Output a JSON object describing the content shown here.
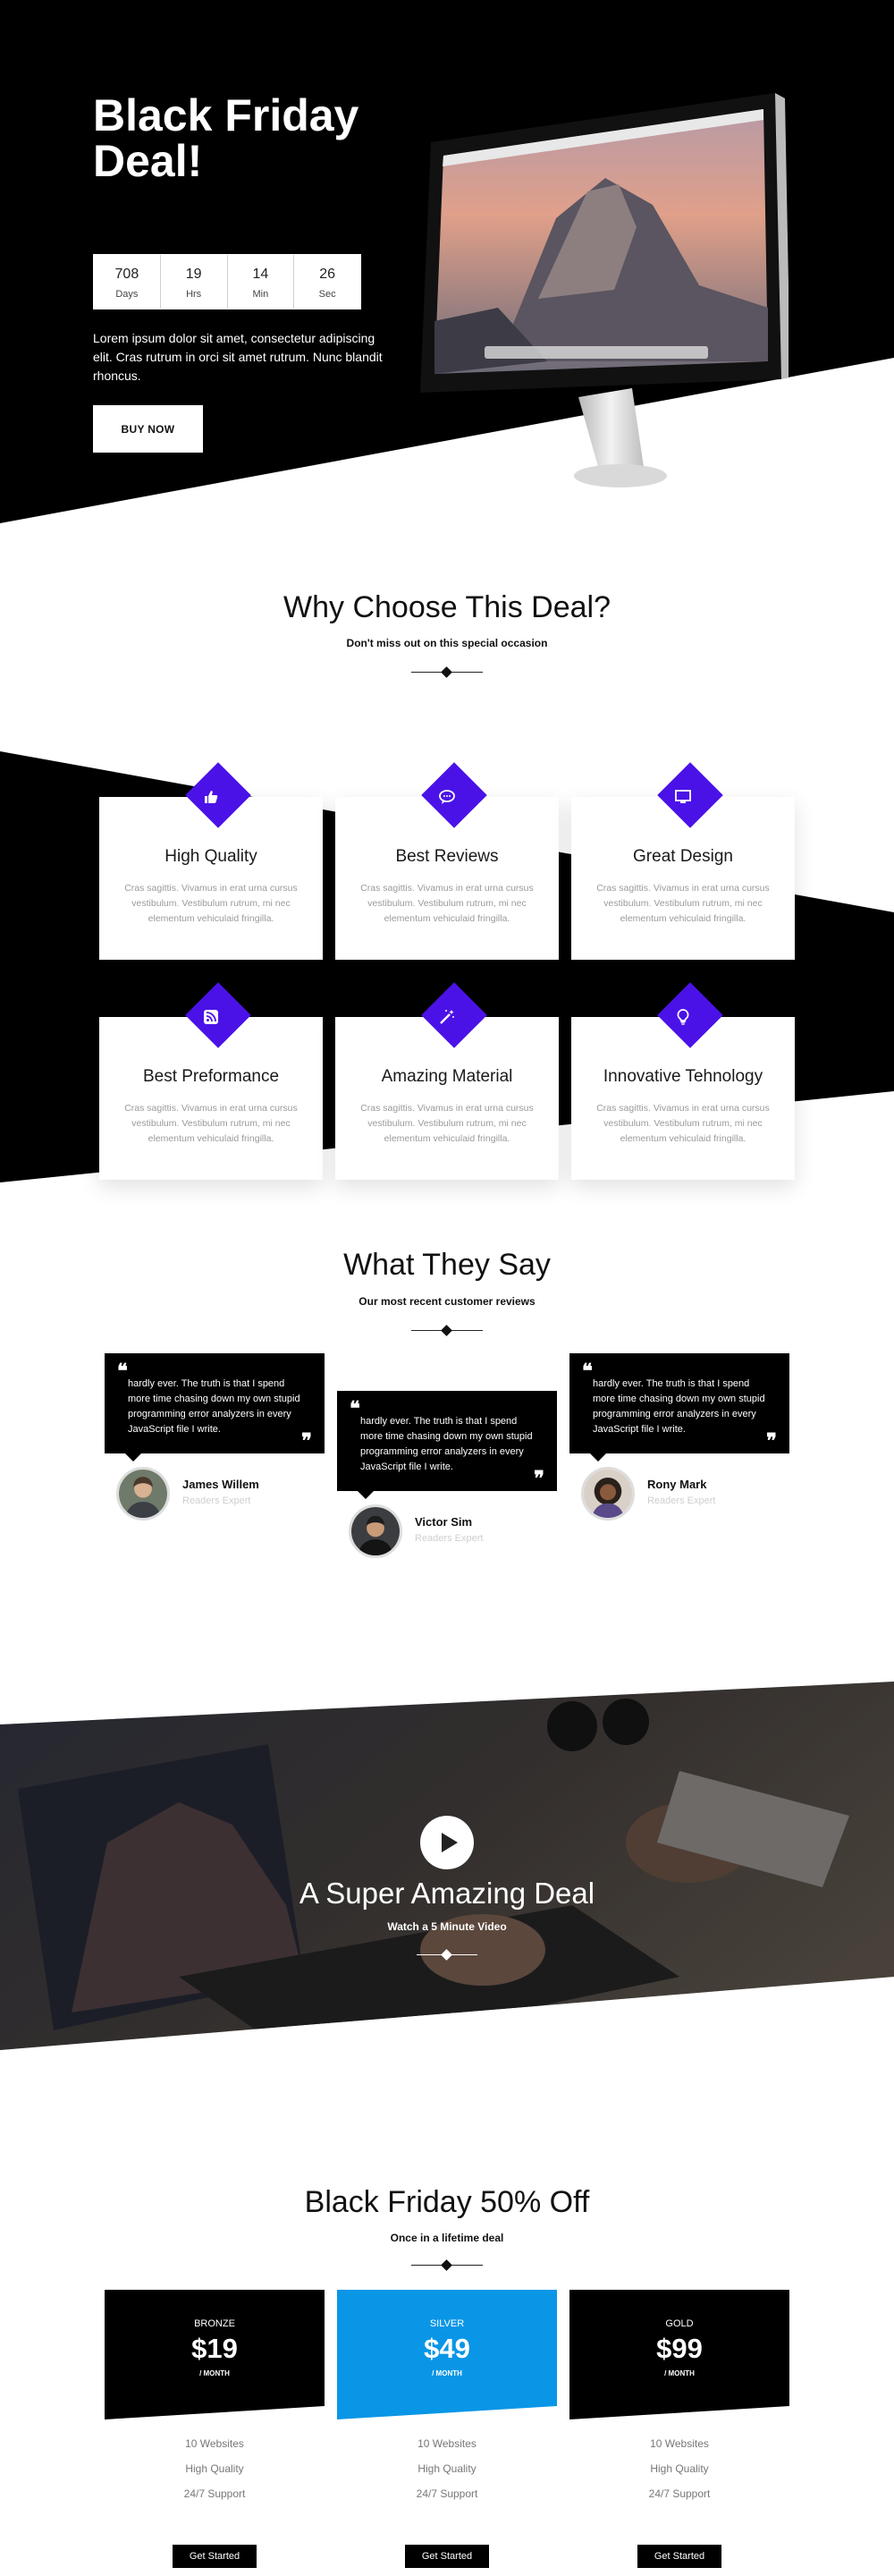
{
  "hero": {
    "title": "Black Friday Deal!",
    "countdown": [
      {
        "value": "708",
        "unit": "Days"
      },
      {
        "value": "19",
        "unit": "Hrs"
      },
      {
        "value": "14",
        "unit": "Min"
      },
      {
        "value": "26",
        "unit": "Sec"
      }
    ],
    "text": "Lorem ipsum dolor sit amet, consectetur adipiscing elit. Cras rutrum in orci sit amet rutrum. Nunc blandit rhoncus.",
    "button": "BUY NOW"
  },
  "why": {
    "title": "Why Choose This Deal?",
    "subtitle": "Don't miss out on this special occasion"
  },
  "features": [
    {
      "title": "High Quality",
      "text": "Cras sagittis. Vivamus in erat urna cursus vestibulum. Vestibulum rutrum, mi nec elementum vehiculaid fringilla.",
      "icon": "thumbs-up-icon"
    },
    {
      "title": "Best Reviews",
      "text": "Cras sagittis. Vivamus in erat urna cursus vestibulum. Vestibulum rutrum, mi nec elementum vehiculaid fringilla.",
      "icon": "chat-icon"
    },
    {
      "title": "Great Design",
      "text": "Cras sagittis. Vivamus in erat urna cursus vestibulum. Vestibulum rutrum, mi nec elementum vehiculaid fringilla.",
      "icon": "monitor-icon"
    },
    {
      "title": "Best Preformance",
      "text": "Cras sagittis. Vivamus in erat urna cursus vestibulum. Vestibulum rutrum, mi nec elementum vehiculaid fringilla.",
      "icon": "rss-icon"
    },
    {
      "title": "Amazing Material",
      "text": "Cras sagittis. Vivamus in erat urna cursus vestibulum. Vestibulum rutrum, mi nec elementum vehiculaid fringilla.",
      "icon": "magic-wand-icon"
    },
    {
      "title": "Innovative Tehnology",
      "text": "Cras sagittis. Vivamus in erat urna cursus vestibulum. Vestibulum rutrum, mi nec elementum vehiculaid fringilla.",
      "icon": "lightbulb-icon"
    }
  ],
  "testimonials": {
    "title": "What They Say",
    "subtitle": "Our most recent customer reviews",
    "items": [
      {
        "quote": "hardly ever. The truth is that I spend more time chasing down my own stupid programming error analyzers in every JavaScript file I write.",
        "name": "James Willem",
        "role": "Readers Expert"
      },
      {
        "quote": "hardly ever. The truth is that I spend more time chasing down my own stupid programming error analyzers in every JavaScript file I write.",
        "name": "Victor Sim",
        "role": "Readers Expert"
      },
      {
        "quote": "hardly ever. The truth is that I spend more time chasing down my own stupid programming error analyzers in every JavaScript file I write.",
        "name": "Rony Mark",
        "role": "Readers Expert"
      }
    ]
  },
  "video": {
    "title": "A Super Amazing Deal",
    "subtitle": "Watch a 5 Minute Video"
  },
  "pricing": {
    "title": "Black Friday 50% Off",
    "subtitle": "Once in a lifetime deal",
    "plans": [
      {
        "name": "BRONZE",
        "price": "$19",
        "period": "/ MONTH",
        "features": [
          "10 Websites",
          "High Quality",
          "24/7 Support"
        ],
        "button": "Get Started",
        "color": "#000000"
      },
      {
        "name": "SILVER",
        "price": "$49",
        "period": "/ MONTH",
        "features": [
          "10 Websites",
          "High Quality",
          "24/7 Support"
        ],
        "button": "Get Started",
        "color": "#0a96e6"
      },
      {
        "name": "GOLD",
        "price": "$99",
        "period": "/ MONTH",
        "features": [
          "10 Websites",
          "High Quality",
          "24/7 Support"
        ],
        "button": "Get Started",
        "color": "#000000"
      }
    ]
  },
  "colors": {
    "accent": "#4b12e8",
    "silver": "#0a96e6",
    "dark": "#000000"
  }
}
